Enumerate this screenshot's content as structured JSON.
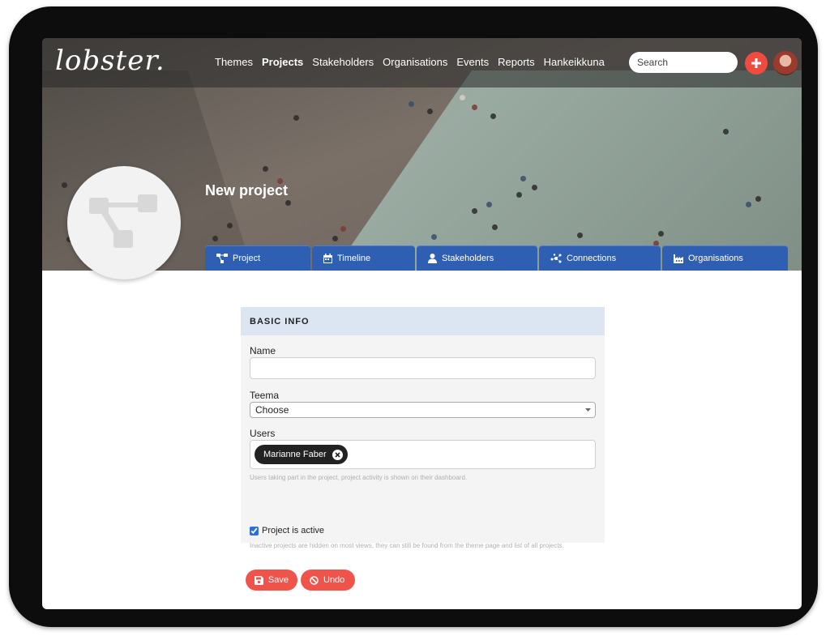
{
  "app": {
    "logo": "lobster."
  },
  "nav": {
    "items": [
      {
        "label": "Themes"
      },
      {
        "label": "Projects"
      },
      {
        "label": "Stakeholders"
      },
      {
        "label": "Organisations"
      },
      {
        "label": "Events"
      },
      {
        "label": "Reports"
      },
      {
        "label": "Hankeikkuna"
      }
    ],
    "active": "Projects"
  },
  "search": {
    "placeholder": "Search"
  },
  "page": {
    "title": "New project"
  },
  "tabs": [
    {
      "label": "Project",
      "icon": "project-tree-icon"
    },
    {
      "label": "Timeline",
      "icon": "calendar-icon"
    },
    {
      "label": "Stakeholders",
      "icon": "user-icon"
    },
    {
      "label": "Connections",
      "icon": "connections-icon"
    },
    {
      "label": "Organisations",
      "icon": "industry-icon"
    }
  ],
  "form": {
    "section_title": "BASIC INFO",
    "name_label": "Name",
    "name_value": "",
    "teema_label": "Teema",
    "teema_value": "Choose",
    "users_label": "Users",
    "users": [
      "Marianne Faber"
    ],
    "users_help": "Users taking part in the project, project activity is shown on their dashboard.",
    "active_label": "Project is active",
    "active_checked": true,
    "active_help": "Inactive projects are hidden on most views, they can still be found from the theme page and list of all projects."
  },
  "buttons": {
    "save": "Save",
    "undo": "Undo"
  },
  "colors": {
    "accent": "#f0534a",
    "tab": "#2f5fb3",
    "section_head": "#dce6f3"
  }
}
